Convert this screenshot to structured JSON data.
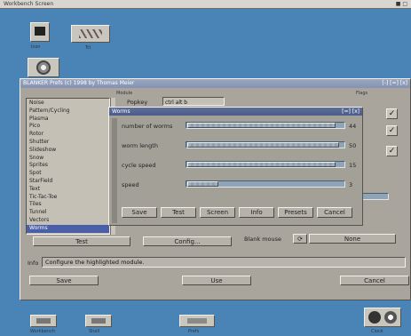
{
  "screen": {
    "title": "Workbench Screen",
    "title_right": "■ □"
  },
  "top_icons": {
    "icon1_label": "Icon",
    "icon2_label": "Tcl"
  },
  "main_window": {
    "title": "BLANKER Prefs (c) 1998 by Thomas Meier",
    "title_right": "[-] [=] [x]",
    "modules_header": "Module",
    "modules": [
      "Noise",
      "Pattern/Cycling",
      "Plasma",
      "Pico",
      "Rotor",
      "Shutter",
      "Slideshow",
      "Snow",
      "Sprites",
      "Spot",
      "StarField",
      "Text",
      "Tic-Tac-Toe",
      "Tiles",
      "Tunnel",
      "Vectors",
      "Worms"
    ],
    "selected_module": "Worms",
    "sub_label": "Popkey",
    "sub_value": "ctrl alt b",
    "info_label": "Info",
    "info_text": "Configure the highlighted module.",
    "test_button": "Test",
    "config_button": "Config...",
    "blank_mouse_label": "Blank mouse",
    "blank_mouse_value": "None",
    "save_button": "Save",
    "use_button": "Use",
    "cancel_button": "Cancel",
    "right_section_label": "Flags"
  },
  "dialog": {
    "title": "Worms",
    "title_right": "[=] [x]",
    "sliders": [
      {
        "label": "number of worms",
        "value": "44",
        "fraction": 0.95
      },
      {
        "label": "worm length",
        "value": "50",
        "fraction": 0.97
      },
      {
        "label": "cycle speed",
        "value": "15",
        "fraction": 0.95
      },
      {
        "label": "speed",
        "value": "3",
        "fraction": 0.2
      }
    ],
    "buttons": [
      "Save",
      "Test",
      "Screen",
      "Info",
      "Presets",
      "Cancel"
    ]
  },
  "taskbar": {
    "items": [
      "Workbench",
      "Shell",
      "Prefs",
      "Clock"
    ]
  },
  "colors": {
    "desktop": "#4a84b6",
    "window": "#a9a59d",
    "selection": "#4b5ea8",
    "slider": "#8fa4b7"
  }
}
